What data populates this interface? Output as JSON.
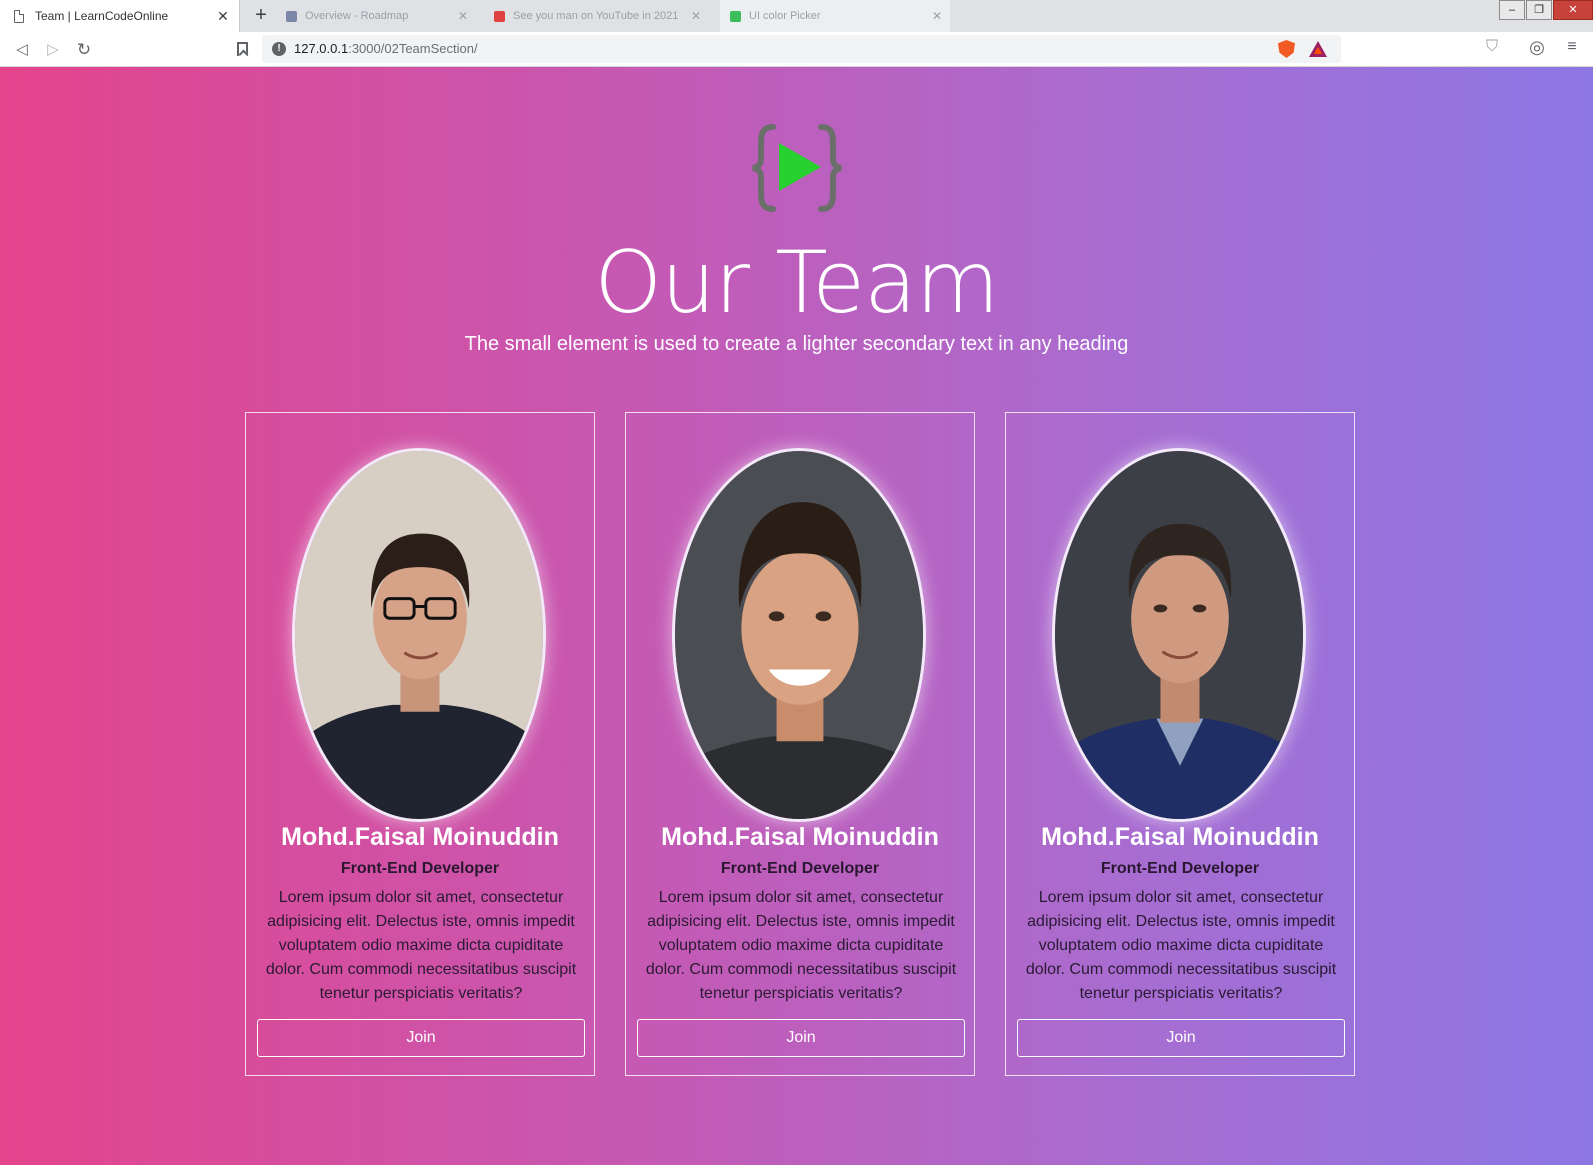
{
  "browser": {
    "active_tab_title": "Team | LearnCodeOnline",
    "inactive_tabs": [
      "Overview - Roadmap",
      "See you man on YouTube in 2021",
      "UI color Picker"
    ],
    "url_host": "127.0.0.1",
    "url_path": ":3000/02TeamSection/",
    "icons": {
      "back": "back-arrow-icon",
      "forward": "forward-arrow-icon",
      "reload": "reload-icon",
      "bookmark": "bookmark-icon",
      "site_info": "info-icon",
      "brave": "brave-shield-icon",
      "rewards": "brave-rewards-icon",
      "profile": "profile-icon",
      "menu": "menu-icon"
    }
  },
  "page": {
    "title": "Our Team",
    "subtitle": "The small element is used to create a lighter secondary text in any heading",
    "logo_color": "#27d130",
    "gradient": [
      "#e4448c",
      "#8c76e4"
    ]
  },
  "team": [
    {
      "name": "Mohd.Faisal Moinuddin",
      "role": "Front-End Developer",
      "bio": "Lorem ipsum dolor sit amet, consectetur adipisicing elit. Delectus iste, omnis impedit voluptatem odio maxime dicta cupiditate dolor. Cum commodi necessitatibus suscipit tenetur perspiciatis veritatis?",
      "button": "Join"
    },
    {
      "name": "Mohd.Faisal Moinuddin",
      "role": "Front-End Developer",
      "bio": "Lorem ipsum dolor sit amet, consectetur adipisicing elit. Delectus iste, omnis impedit voluptatem odio maxime dicta cupiditate dolor. Cum commodi necessitatibus suscipit tenetur perspiciatis veritatis?",
      "button": "Join"
    },
    {
      "name": "Mohd.Faisal Moinuddin",
      "role": "Front-End Developer",
      "bio": "Lorem ipsum dolor sit amet, consectetur adipisicing elit. Delectus iste, omnis impedit voluptatem odio maxime dicta cupiditate dolor. Cum commodi necessitatibus suscipit tenetur perspiciatis veritatis?",
      "button": "Join"
    }
  ]
}
